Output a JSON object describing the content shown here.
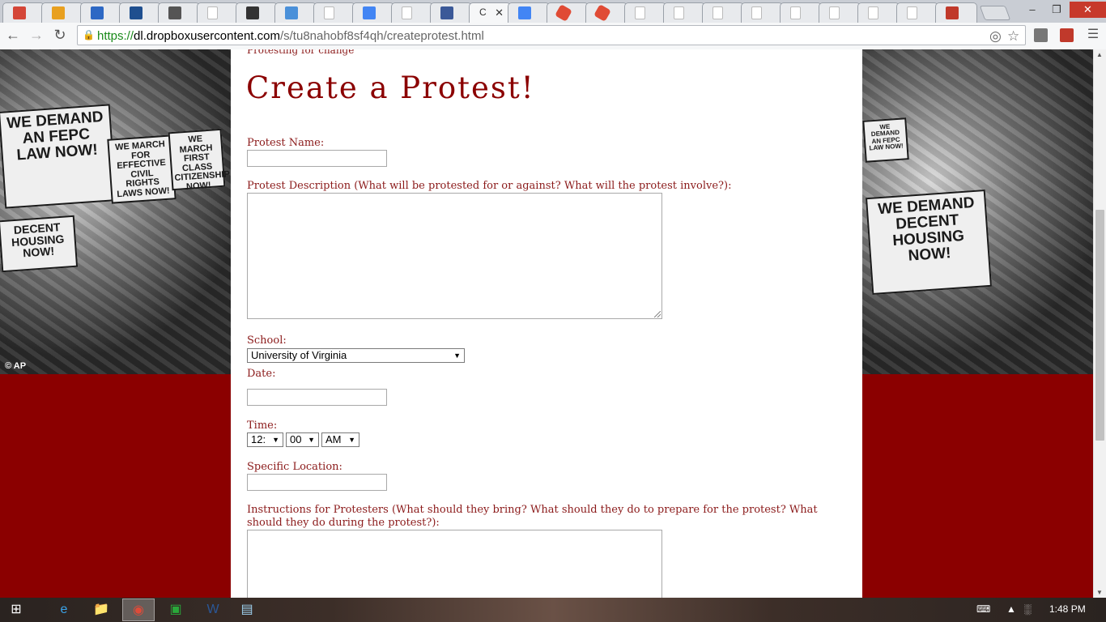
{
  "browser": {
    "tabs": [
      {
        "icon": "gmail-icon",
        "color": "#d44638"
      },
      {
        "icon": "pinwheel-icon",
        "color": "#e8a020"
      },
      {
        "icon": "ucla-icon",
        "color": "#2d68c4"
      },
      {
        "icon": "s-icon",
        "color": "#1f4f8f"
      },
      {
        "icon": "wikipedia-icon",
        "color": "#555555"
      },
      {
        "icon": "page-icon",
        "color": "#bbbbbb"
      },
      {
        "icon": "mask-icon",
        "color": "#333333"
      },
      {
        "icon": "zotero-icon",
        "color": "#4a90d9"
      },
      {
        "icon": "page-icon",
        "color": "#bbbbbb"
      },
      {
        "icon": "google-icon",
        "color": "#4285f4"
      },
      {
        "icon": "page-icon",
        "color": "#bbbbbb"
      },
      {
        "icon": "facebook-icon",
        "color": "#3b5998"
      },
      {
        "icon": "active-page",
        "color": "#ffffff"
      },
      {
        "icon": "docs-icon",
        "color": "#4285f4"
      },
      {
        "icon": "hexagon-icon",
        "color": "#e04b35"
      },
      {
        "icon": "hexagon-icon",
        "color": "#e04b35"
      },
      {
        "icon": "page-icon",
        "color": "#bbbbbb"
      },
      {
        "icon": "page-icon",
        "color": "#bbbbbb"
      },
      {
        "icon": "page-icon",
        "color": "#bbbbbb"
      },
      {
        "icon": "page-icon",
        "color": "#bbbbbb"
      },
      {
        "icon": "page-icon",
        "color": "#bbbbbb"
      },
      {
        "icon": "page-icon",
        "color": "#bbbbbb"
      },
      {
        "icon": "page-icon",
        "color": "#bbbbbb"
      },
      {
        "icon": "page-icon",
        "color": "#bbbbbb"
      },
      {
        "icon": "m-icon",
        "color": "#c0392b"
      }
    ],
    "active_tab_title": "C",
    "tab_close": "✕",
    "url_scheme": "https://",
    "url_host": "dl.dropboxusercontent.com",
    "url_path": "/s/tu8nahobf8sf4qh/createprotest.html",
    "window": {
      "minimize": "‒",
      "restore": "❐",
      "close": "✕"
    }
  },
  "page": {
    "cut_text": "Protesting for change",
    "title": "Create a Protest!",
    "labels": {
      "name": "Protest Name:",
      "description": "Protest Description (What will be protested for or against? What will the protest involve?):",
      "school": "School:",
      "date": "Date:",
      "time": "Time:",
      "location": "Specific Location:",
      "instructions": "Instructions for Protesters (What should they bring? What should they do to prepare for the protest? What",
      "instructions_line2": "should they do during the protest?):"
    },
    "fields": {
      "name_value": "",
      "description_value": "",
      "school_selected": "University of Virginia",
      "date_value": "",
      "hour_selected": "12:",
      "minute_selected": "00",
      "ampm_selected": "AM",
      "location_value": "",
      "instructions_value": ""
    },
    "photo_left_signs": [
      "WE DEMAND AN FEPC LAW NOW!",
      "WE MARCH FOR EFFECTIVE CIVIL RIGHTS LAWS NOW!",
      "WE MARCH FIRST CLASS CITIZENSHIP NOW!",
      "DECENT HOUSING NOW!"
    ],
    "photo_right_signs": [
      "WE DEMAND DECENT HOUSING NOW!",
      "WE DEMAND AN FEPC LAW NOW!"
    ],
    "photo_credit": "© AP"
  },
  "taskbar": {
    "clock": "1:48 PM"
  },
  "colors": {
    "accent": "#8b0000",
    "label": "#8b1a1a"
  }
}
